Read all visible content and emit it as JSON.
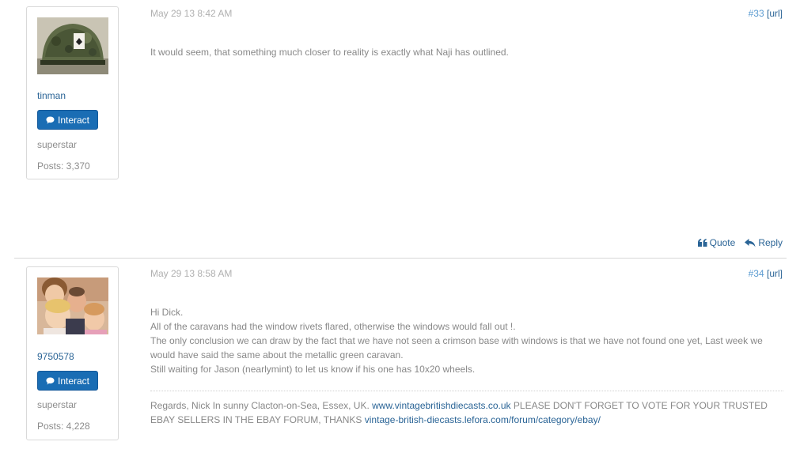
{
  "posts": [
    {
      "author": "tinman",
      "interact_label": "Interact",
      "rank": "superstar",
      "posts_count": "Posts: 3,370",
      "date": "May 29 13 8:42 AM",
      "post_number": "#33",
      "url_label": "[url]",
      "body": [
        "It would seem, that something much closer to reality is exactly what Naji has outlined."
      ]
    },
    {
      "author": "9750578",
      "interact_label": "Interact",
      "rank": "superstar",
      "posts_count": "Posts: 4,228",
      "date": "May 29 13 8:58 AM",
      "post_number": "#34",
      "url_label": "[url]",
      "body": [
        "Hi Dick.",
        "All of the caravans had the window rivets flared, otherwise the windows would fall out !.",
        "The only conclusion we can draw by the fact that we have not seen a crimson base with windows is that we have not found one yet, Last week we would have said the same about the metallic green caravan.",
        "Still waiting for Jason (nearlymint) to let us know if his one has 10x20 wheels."
      ],
      "signature": {
        "text1": "Regards, Nick In sunny Clacton-on-Sea, Essex, UK.",
        "link1": "www.vintagebritishdiecasts.co.uk",
        "text2": "PLEASE DON'T FORGET TO VOTE FOR YOUR TRUSTED EBAY SELLERS IN THE EBAY FORUM, THANKS",
        "link2": "vintage-british-diecasts.lefora.com/forum/category/ebay/"
      }
    }
  ],
  "actions": {
    "quote_label": "Quote",
    "reply_label": "Reply"
  },
  "colors": {
    "link": "#2a6496",
    "button": "#1a6db4",
    "meta": "#b0b0b0",
    "text": "#888888"
  }
}
